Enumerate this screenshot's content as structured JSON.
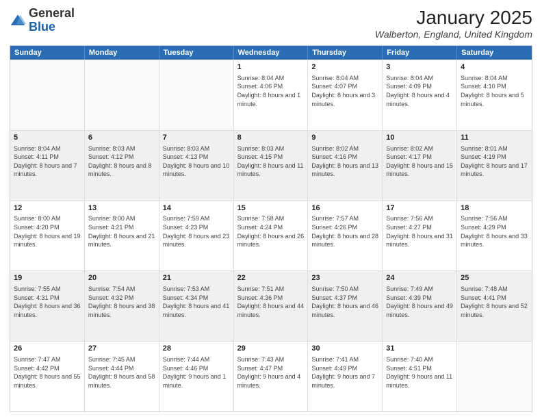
{
  "logo": {
    "general": "General",
    "blue": "Blue"
  },
  "title": {
    "month_year": "January 2025",
    "location": "Walberton, England, United Kingdom"
  },
  "weekdays": [
    "Sunday",
    "Monday",
    "Tuesday",
    "Wednesday",
    "Thursday",
    "Friday",
    "Saturday"
  ],
  "rows": [
    [
      {
        "day": "",
        "text": "",
        "empty": true
      },
      {
        "day": "",
        "text": "",
        "empty": true
      },
      {
        "day": "",
        "text": "",
        "empty": true
      },
      {
        "day": "1",
        "text": "Sunrise: 8:04 AM\nSunset: 4:06 PM\nDaylight: 8 hours and 1 minute."
      },
      {
        "day": "2",
        "text": "Sunrise: 8:04 AM\nSunset: 4:07 PM\nDaylight: 8 hours and 3 minutes."
      },
      {
        "day": "3",
        "text": "Sunrise: 8:04 AM\nSunset: 4:09 PM\nDaylight: 8 hours and 4 minutes."
      },
      {
        "day": "4",
        "text": "Sunrise: 8:04 AM\nSunset: 4:10 PM\nDaylight: 8 hours and 5 minutes."
      }
    ],
    [
      {
        "day": "5",
        "text": "Sunrise: 8:04 AM\nSunset: 4:11 PM\nDaylight: 8 hours and 7 minutes.",
        "shaded": true
      },
      {
        "day": "6",
        "text": "Sunrise: 8:03 AM\nSunset: 4:12 PM\nDaylight: 8 hours and 8 minutes.",
        "shaded": true
      },
      {
        "day": "7",
        "text": "Sunrise: 8:03 AM\nSunset: 4:13 PM\nDaylight: 8 hours and 10 minutes.",
        "shaded": true
      },
      {
        "day": "8",
        "text": "Sunrise: 8:03 AM\nSunset: 4:15 PM\nDaylight: 8 hours and 11 minutes.",
        "shaded": true
      },
      {
        "day": "9",
        "text": "Sunrise: 8:02 AM\nSunset: 4:16 PM\nDaylight: 8 hours and 13 minutes.",
        "shaded": true
      },
      {
        "day": "10",
        "text": "Sunrise: 8:02 AM\nSunset: 4:17 PM\nDaylight: 8 hours and 15 minutes.",
        "shaded": true
      },
      {
        "day": "11",
        "text": "Sunrise: 8:01 AM\nSunset: 4:19 PM\nDaylight: 8 hours and 17 minutes.",
        "shaded": true
      }
    ],
    [
      {
        "day": "12",
        "text": "Sunrise: 8:00 AM\nSunset: 4:20 PM\nDaylight: 8 hours and 19 minutes."
      },
      {
        "day": "13",
        "text": "Sunrise: 8:00 AM\nSunset: 4:21 PM\nDaylight: 8 hours and 21 minutes."
      },
      {
        "day": "14",
        "text": "Sunrise: 7:59 AM\nSunset: 4:23 PM\nDaylight: 8 hours and 23 minutes."
      },
      {
        "day": "15",
        "text": "Sunrise: 7:58 AM\nSunset: 4:24 PM\nDaylight: 8 hours and 26 minutes."
      },
      {
        "day": "16",
        "text": "Sunrise: 7:57 AM\nSunset: 4:26 PM\nDaylight: 8 hours and 28 minutes."
      },
      {
        "day": "17",
        "text": "Sunrise: 7:56 AM\nSunset: 4:27 PM\nDaylight: 8 hours and 31 minutes."
      },
      {
        "day": "18",
        "text": "Sunrise: 7:56 AM\nSunset: 4:29 PM\nDaylight: 8 hours and 33 minutes."
      }
    ],
    [
      {
        "day": "19",
        "text": "Sunrise: 7:55 AM\nSunset: 4:31 PM\nDaylight: 8 hours and 36 minutes.",
        "shaded": true
      },
      {
        "day": "20",
        "text": "Sunrise: 7:54 AM\nSunset: 4:32 PM\nDaylight: 8 hours and 38 minutes.",
        "shaded": true
      },
      {
        "day": "21",
        "text": "Sunrise: 7:53 AM\nSunset: 4:34 PM\nDaylight: 8 hours and 41 minutes.",
        "shaded": true
      },
      {
        "day": "22",
        "text": "Sunrise: 7:51 AM\nSunset: 4:36 PM\nDaylight: 8 hours and 44 minutes.",
        "shaded": true
      },
      {
        "day": "23",
        "text": "Sunrise: 7:50 AM\nSunset: 4:37 PM\nDaylight: 8 hours and 46 minutes.",
        "shaded": true
      },
      {
        "day": "24",
        "text": "Sunrise: 7:49 AM\nSunset: 4:39 PM\nDaylight: 8 hours and 49 minutes.",
        "shaded": true
      },
      {
        "day": "25",
        "text": "Sunrise: 7:48 AM\nSunset: 4:41 PM\nDaylight: 8 hours and 52 minutes.",
        "shaded": true
      }
    ],
    [
      {
        "day": "26",
        "text": "Sunrise: 7:47 AM\nSunset: 4:42 PM\nDaylight: 8 hours and 55 minutes."
      },
      {
        "day": "27",
        "text": "Sunrise: 7:45 AM\nSunset: 4:44 PM\nDaylight: 8 hours and 58 minutes."
      },
      {
        "day": "28",
        "text": "Sunrise: 7:44 AM\nSunset: 4:46 PM\nDaylight: 9 hours and 1 minute."
      },
      {
        "day": "29",
        "text": "Sunrise: 7:43 AM\nSunset: 4:47 PM\nDaylight: 9 hours and 4 minutes."
      },
      {
        "day": "30",
        "text": "Sunrise: 7:41 AM\nSunset: 4:49 PM\nDaylight: 9 hours and 7 minutes."
      },
      {
        "day": "31",
        "text": "Sunrise: 7:40 AM\nSunset: 4:51 PM\nDaylight: 9 hours and 11 minutes."
      },
      {
        "day": "",
        "text": "",
        "empty": true
      }
    ]
  ]
}
